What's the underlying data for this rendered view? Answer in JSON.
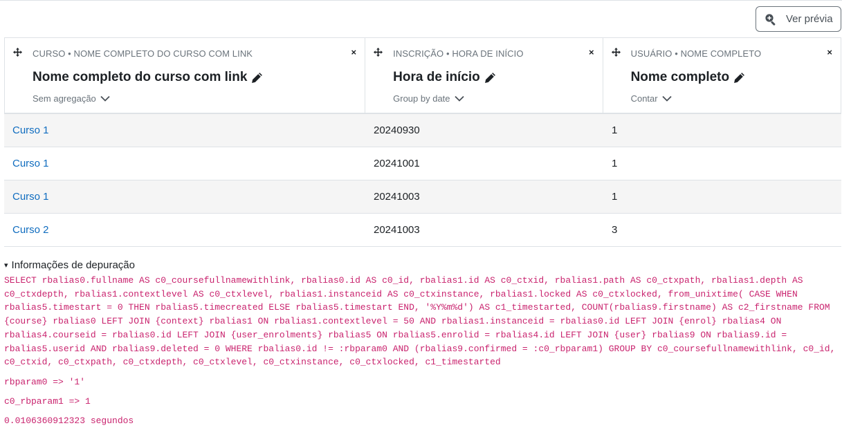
{
  "toolbar": {
    "preview_label": "Ver prévia"
  },
  "columns": [
    {
      "category": "CURSO • NOME COMPLETO DO CURSO COM LINK",
      "title": "Nome completo do curso com link",
      "aggregation": "Sem agregação",
      "close": "×"
    },
    {
      "category": "INSCRIÇÃO • HORA DE INÍCIO",
      "title": "Hora de início",
      "aggregation": "Group by date",
      "close": "×"
    },
    {
      "category": "USUÁRIO • NOME COMPLETO",
      "title": "Nome completo",
      "aggregation": "Contar",
      "close": "×"
    }
  ],
  "rows": [
    {
      "course": "Curso 1",
      "start": "20240930",
      "count": "1"
    },
    {
      "course": "Curso 1",
      "start": "20241001",
      "count": "1"
    },
    {
      "course": "Curso 1",
      "start": "20241003",
      "count": "1"
    },
    {
      "course": "Curso 2",
      "start": "20241003",
      "count": "3"
    }
  ],
  "debug": {
    "summary": "Informações de depuração",
    "triangle": "▾",
    "sql": "SELECT rbalias0.fullname AS c0_coursefullnamewithlink, rbalias0.id AS c0_id, rbalias1.id AS c0_ctxid, rbalias1.path AS c0_ctxpath, rbalias1.depth AS c0_ctxdepth, rbalias1.contextlevel AS c0_ctxlevel, rbalias1.instanceid AS c0_ctxinstance, rbalias1.locked AS c0_ctxlocked, from_unixtime( CASE WHEN rbalias5.timestart = 0 THEN rbalias5.timecreated ELSE rbalias5.timestart END, '%Y%m%d') AS c1_timestarted, COUNT(rbalias9.firstname) AS c2_firstname FROM {course} rbalias0 LEFT JOIN {context} rbalias1 ON rbalias1.contextlevel = 50 AND rbalias1.instanceid = rbalias0.id LEFT JOIN {enrol} rbalias4 ON rbalias4.courseid = rbalias0.id LEFT JOIN {user_enrolments} rbalias5 ON rbalias5.enrolid = rbalias4.id LEFT JOIN {user} rbalias9 ON rbalias9.id = rbalias5.userid AND rbalias9.deleted = 0 WHERE rbalias0.id != :rbparam0 AND (rbalias9.confirmed = :c0_rbparam1) GROUP BY c0_coursefullnamewithlink, c0_id, c0_ctxid, c0_ctxpath, c0_ctxdepth, c0_ctxlevel, c0_ctxinstance, c0_ctxlocked, c1_timestarted",
    "param0": "rbparam0 => '1'",
    "param1": "c0_rbparam1 => 1",
    "timing": "0.0106360912323 segundos"
  },
  "icons": {
    "preview": "search-plus-icon",
    "move": "move-arrows-icon",
    "close": "close-icon",
    "edit": "pencil-icon",
    "chevron": "chevron-down-icon"
  }
}
